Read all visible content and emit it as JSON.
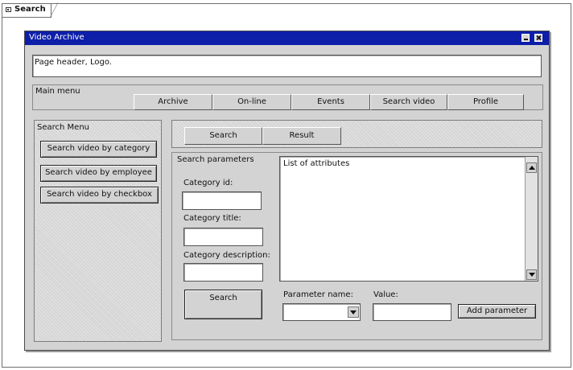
{
  "frame": {
    "tab_label": "Search"
  },
  "window": {
    "title": "Video Archive",
    "header_text": "Page header, Logo."
  },
  "main_menu": {
    "label": "Main menu",
    "tabs": [
      "Archive",
      "On-line",
      "Events",
      "Search video",
      "Profile"
    ]
  },
  "search_menu": {
    "label": "Search Menu",
    "items": [
      "Search video by category",
      "Search video by employee",
      "Search video by checkbox"
    ]
  },
  "view_tabs": {
    "search": "Search",
    "result": "Result"
  },
  "search_params": {
    "label": "Search parameters",
    "category_id_label": "Category id:",
    "category_id_value": "",
    "category_title_label": "Category title:",
    "category_title_value": "",
    "category_description_label": "Category description:",
    "category_description_value": "",
    "search_button": "Search",
    "attributes_list_text": "List of attributes",
    "parameter_name_label": "Parameter name:",
    "parameter_name_value": "",
    "value_label": "Value:",
    "value_value": "",
    "add_parameter_button": "Add parameter"
  },
  "icons": {
    "frame_icon": "diagram-frame-icon",
    "minimize": "minimize-icon",
    "close": "close-icon",
    "scroll_up": "arrow-up-icon",
    "scroll_down": "arrow-down-icon",
    "dropdown": "chevron-down-icon"
  },
  "colors": {
    "titlebar": "#0d1ea9",
    "panel": "#d3d3d3",
    "field": "#ffffff"
  }
}
